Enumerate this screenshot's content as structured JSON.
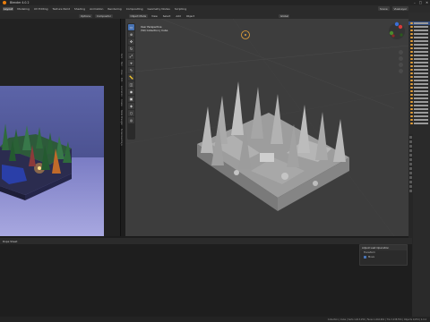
{
  "app": {
    "title": "Blender 4.0.2"
  },
  "menu": {
    "items": [
      "Layout",
      "Modeling",
      "UV Editing",
      "Texture Paint",
      "Shading",
      "Animation",
      "Rendering",
      "Compositing",
      "Geometry Nodes",
      "Scripting"
    ],
    "active_index": 0,
    "scene_label": "Scene",
    "view_layer_label": "ViewLayer"
  },
  "render_panel": {
    "header_items": [
      "Options",
      "Compositor"
    ]
  },
  "viewport": {
    "header_buttons": [
      "Object Mode",
      "View",
      "Select",
      "Add",
      "Object"
    ],
    "orientation_label": "Global",
    "info_line1": "User Perspective",
    "info_line2": "(59) Collection | Cube",
    "side_tabs": [
      "Item",
      "Tool",
      "View",
      "Edit",
      "Animation",
      "Create",
      "Node Wrangler",
      "Screencast Keys"
    ]
  },
  "timeline": {
    "header_label": "Dope Sheet"
  },
  "redo_panel": {
    "title": "Adjust Last Operation",
    "row1": "Transform",
    "row2": "Move"
  },
  "status": {
    "text": "Collection | Cube | Verts 1,613,254 | Faces 1,642,961 | Tris 3,238,554 | Objects 1/254 | 4.0.2"
  },
  "colors": {
    "accent": "#4772b3",
    "blender_orange": "#e87d0d",
    "viewport_bg": "#3d3d3d"
  },
  "icons": [
    "blender-logo-icon",
    "minimize-icon",
    "maximize-icon",
    "close-icon",
    "select-box-icon",
    "cursor-icon",
    "move-icon",
    "rotate-icon",
    "scale-icon",
    "transform-icon",
    "annotate-icon",
    "measure-icon",
    "add-cube-icon",
    "light-bulb-icon",
    "camera-icon",
    "navigation-gizmo-icon",
    "zoom-icon",
    "pan-icon"
  ]
}
